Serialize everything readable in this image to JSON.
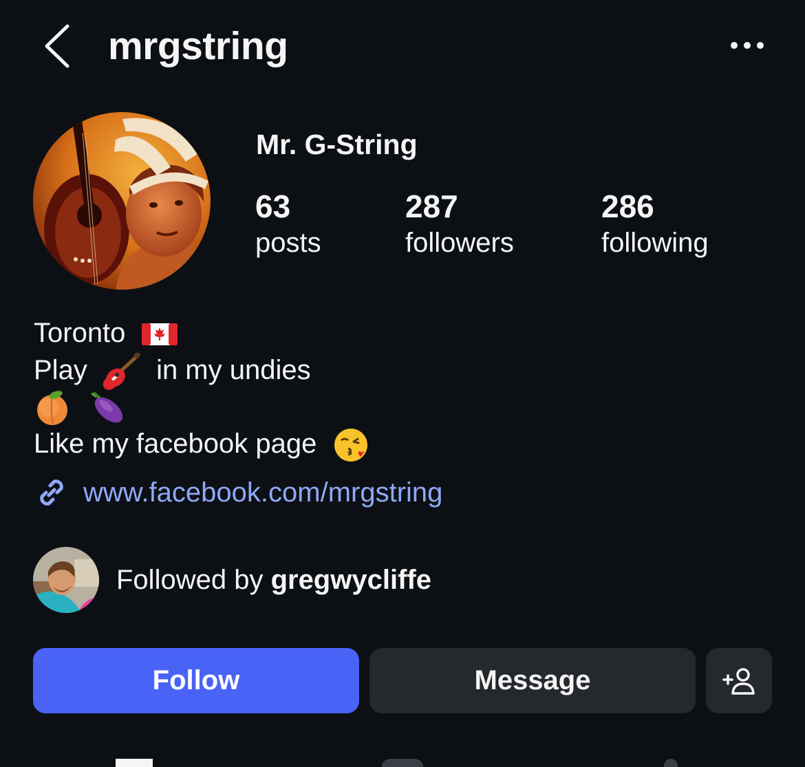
{
  "header": {
    "username": "mrgstring",
    "back_icon": "chevron-left-icon",
    "more_icon": "more-horizontal-icon"
  },
  "profile": {
    "display_name": "Mr. G-String",
    "stats": [
      {
        "value": "63",
        "label": "posts"
      },
      {
        "value": "287",
        "label": "followers"
      },
      {
        "value": "286",
        "label": "following"
      }
    ]
  },
  "bio": {
    "line1": "Toronto",
    "line1_emoji": "canada-flag-emoji",
    "line2_before": "Play",
    "line2_emoji": "guitar-emoji",
    "line2_after": "in my undies",
    "line3_emojis": [
      "peach-emoji",
      "eggplant-emoji"
    ],
    "line4": "Like my facebook page",
    "line4_emoji": "kissing-face-emoji",
    "link_icon": "link-icon",
    "link": "www.facebook.com/mrgstring"
  },
  "followed_by": {
    "prefix": "Followed by",
    "name": "gregwycliffe"
  },
  "actions": {
    "follow": "Follow",
    "message": "Message",
    "add_user_icon": "add-user-icon"
  },
  "colors": {
    "background": "#0c1014",
    "text": "#f5f5f5",
    "follow_button": "#4a63f7",
    "secondary_button": "#25292e",
    "link": "#8fa8f8"
  }
}
